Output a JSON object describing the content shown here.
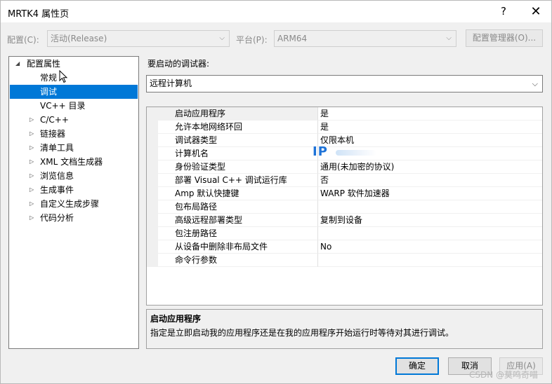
{
  "window": {
    "title": "MRTK4 属性页",
    "help": "?",
    "close": "✕"
  },
  "toolbar": {
    "config_label": "配置(C):",
    "config_value": "活动(Release)",
    "platform_label": "平台(P):",
    "platform_value": "ARM64",
    "config_manager": "配置管理器(O)..."
  },
  "tree": {
    "root": "配置属性",
    "items": [
      {
        "label": "常规"
      },
      {
        "label": "调试"
      },
      {
        "label": "VC++ 目录"
      },
      {
        "label": "C/C++"
      },
      {
        "label": "链接器"
      },
      {
        "label": "清单工具"
      },
      {
        "label": "XML 文档生成器"
      },
      {
        "label": "浏览信息"
      },
      {
        "label": "生成事件"
      },
      {
        "label": "自定义生成步骤"
      },
      {
        "label": "代码分析"
      }
    ]
  },
  "debugger": {
    "label": "要启动的调试器:",
    "value": "远程计算机"
  },
  "grid": {
    "rows": [
      {
        "name": "启动应用程序",
        "value": "是"
      },
      {
        "name": "允许本地网络环回",
        "value": "是"
      },
      {
        "name": "调试器类型",
        "value": "仅限本机"
      },
      {
        "name": "计算机名",
        "value": "IP"
      },
      {
        "name": "身份验证类型",
        "value": "通用(未加密的协议)"
      },
      {
        "name": "部署 Visual C++ 调试运行库",
        "value": "否"
      },
      {
        "name": "Amp 默认快捷键",
        "value": "WARP 软件加速器"
      },
      {
        "name": "包布局路径",
        "value": ""
      },
      {
        "name": "高级远程部署类型",
        "value": "复制到设备"
      },
      {
        "name": "包注册路径",
        "value": ""
      },
      {
        "name": "从设备中删除非布局文件",
        "value": "No"
      },
      {
        "name": "命令行参数",
        "value": ""
      }
    ]
  },
  "description": {
    "title": "启动应用程序",
    "text": "指定是立即启动我的应用程序还是在我的应用程序开始运行时等待对其进行调试。"
  },
  "buttons": {
    "ok": "确定",
    "cancel": "取消",
    "apply": "应用(A)"
  },
  "watermark": "CSDN @莫鸣奇喵"
}
